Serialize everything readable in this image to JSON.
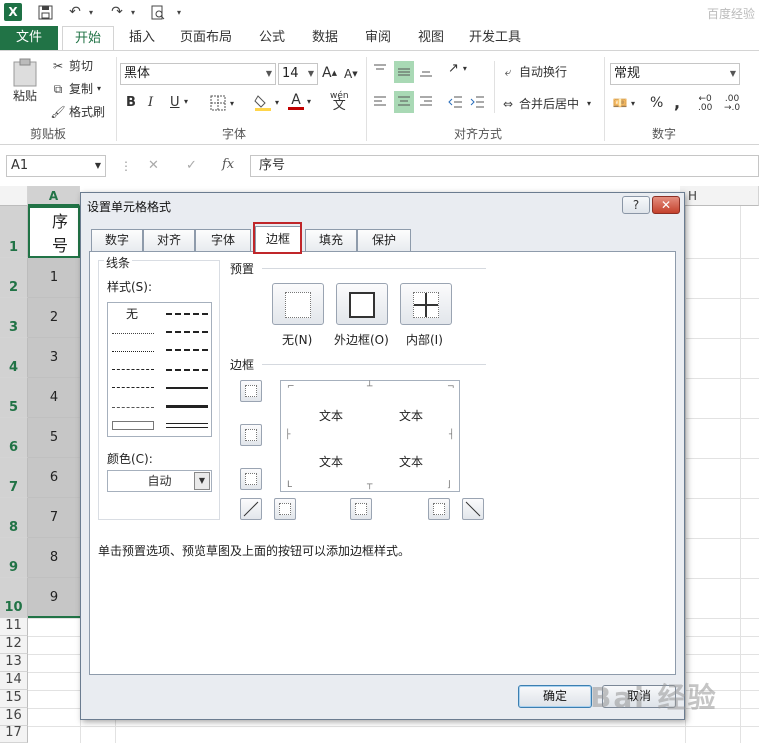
{
  "app": {
    "watermark_top": "百度经验",
    "watermark_bottom": "Bai 经验"
  },
  "qat": {
    "excel_logo": "X",
    "save_icon": "save-icon",
    "undo_icon": "undo-icon",
    "redo_icon": "redo-icon",
    "preview_icon": "print-preview-icon"
  },
  "tabs": [
    "文件",
    "开始",
    "插入",
    "页面布局",
    "公式",
    "数据",
    "审阅",
    "视图",
    "开发工具"
  ],
  "ribbon": {
    "paste": "粘贴",
    "cut": "剪切",
    "copy": "复制",
    "format_painter": "格式刷",
    "clipboard_group": "剪贴板",
    "font_name": "黑体",
    "font_size": "14",
    "font_group": "字体",
    "bold": "B",
    "italic": "I",
    "underline": "U",
    "grow_font": "A",
    "shrink_font": "A",
    "phonetic": "wén",
    "wrap_text": "自动换行",
    "merge_center": "合并后居中",
    "align_group": "对齐方式",
    "number_format": "常规",
    "percent": "%",
    "comma": ",",
    "number_group": "数字",
    "colors": {
      "accent": "#217346",
      "highlight": "#a9d9b5",
      "fill_color": "#ffd54a",
      "font_color": "#c00000"
    }
  },
  "formula_bar": {
    "name_box": "A1",
    "fx": "fx",
    "cancel": "✕",
    "enter": "✓",
    "formula": "序号"
  },
  "grid": {
    "columns": [
      "A",
      "H"
    ],
    "rows": [
      "1",
      "2",
      "3",
      "4",
      "5",
      "6",
      "7",
      "8",
      "9",
      "10",
      "11",
      "12",
      "13",
      "14",
      "15",
      "16",
      "17"
    ],
    "a_values": [
      "序号",
      "1",
      "2",
      "3",
      "4",
      "5",
      "6",
      "7",
      "8",
      "9"
    ]
  },
  "dialog": {
    "title": "设置单元格格式",
    "help": "?",
    "close": "✕",
    "tabs": [
      "数字",
      "对齐",
      "字体",
      "边框",
      "填充",
      "保护"
    ],
    "line_section": "线条",
    "style_label": "样式(S):",
    "style_none": "无",
    "color_label": "颜色(C):",
    "color_value": "自动",
    "preset_section": "预置",
    "preset_none": "无(N)",
    "preset_outline": "外边框(O)",
    "preset_inside": "内部(I)",
    "border_section": "边框",
    "preview_text": "文本",
    "hint": "单击预置选项、预览草图及上面的按钮可以添加边框样式。",
    "ok": "确定",
    "cancel": "取消"
  }
}
